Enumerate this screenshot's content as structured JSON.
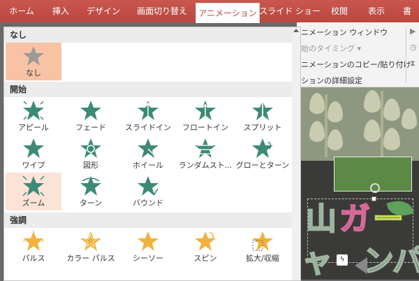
{
  "tabs": [
    {
      "label": "ホーム",
      "active": false
    },
    {
      "label": "挿入",
      "active": false
    },
    {
      "label": "デザイン",
      "active": false
    },
    {
      "label": "画面切り替え",
      "active": false
    },
    {
      "label": "アニメーション",
      "active": true
    },
    {
      "label": "スライド ショー",
      "active": false
    },
    {
      "label": "校閲",
      "active": false
    },
    {
      "label": "表示",
      "active": false
    },
    {
      "label": "書",
      "active": false
    }
  ],
  "ribbon": {
    "animation_window": "ニメーション ウィンドウ",
    "timing": "始のタイミング",
    "copy_paste": "ニメーションのコピー/貼り付け",
    "details": "ションの詳細設定"
  },
  "gallery": {
    "sections": {
      "none": "なし",
      "entrance": "開始",
      "emphasis": "強調"
    },
    "none_items": [
      {
        "label": "なし",
        "icon": "none-star-icon",
        "selected": true
      }
    ],
    "entrance_items": [
      {
        "label": "アピール",
        "icon": "appear-star-icon"
      },
      {
        "label": "フェード",
        "icon": "fade-star-icon"
      },
      {
        "label": "スライドイン",
        "icon": "fly-in-star-icon"
      },
      {
        "label": "フロートイン",
        "icon": "float-in-star-icon"
      },
      {
        "label": "スプリット",
        "icon": "split-star-icon"
      },
      {
        "label": "ワイプ",
        "icon": "wipe-star-icon"
      },
      {
        "label": "図形",
        "icon": "shape-star-icon"
      },
      {
        "label": "ホイール",
        "icon": "wheel-star-icon"
      },
      {
        "label": "ランダムスト...",
        "icon": "random-bars-star-icon"
      },
      {
        "label": "グローとターン",
        "icon": "grow-turn-star-icon"
      },
      {
        "label": "ズーム",
        "icon": "zoom-star-icon",
        "hover": true
      },
      {
        "label": "ターン",
        "icon": "swivel-star-icon"
      },
      {
        "label": "バウンド",
        "icon": "bounce-star-icon"
      }
    ],
    "emphasis_items": [
      {
        "label": "パルス",
        "icon": "pulse-star-icon"
      },
      {
        "label": "カラー パルス",
        "icon": "color-pulse-star-icon"
      },
      {
        "label": "シーソー",
        "icon": "teeter-star-icon"
      },
      {
        "label": "スピン",
        "icon": "spin-star-icon"
      },
      {
        "label": "拡大/収縮",
        "icon": "grow-shrink-star-icon"
      }
    ]
  },
  "slide": {
    "title_chars": [
      "山",
      "ガ",
      "ー"
    ],
    "subtitle_chars": [
      "ャ",
      "ン",
      "パ"
    ]
  },
  "colors": {
    "accent": "#c0504d",
    "entrance_star": "#3c8a76",
    "emphasis_star": "#f0b23c",
    "none_star": "#9a9a9a",
    "selected_bg": "#f8c3a5",
    "hover_bg": "#fbe3d7"
  }
}
